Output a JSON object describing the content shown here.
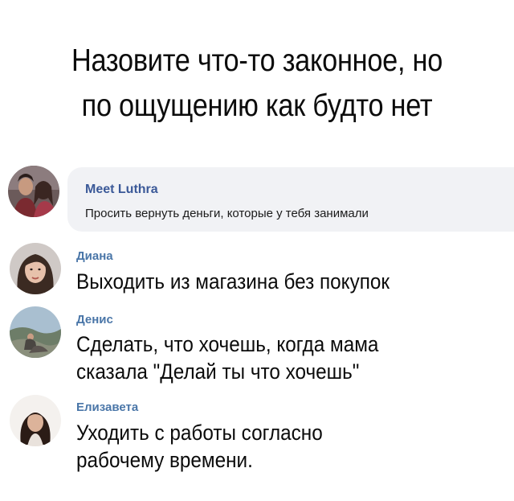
{
  "title": {
    "line1": "Назовите что-то законное, но",
    "line2": "по ощущению как будто нет"
  },
  "featured_comment": {
    "author": "Meet Luthra",
    "text": "Просить вернуть деньги, которые у тебя занимали"
  },
  "comments": [
    {
      "author": "Диана",
      "lines": [
        "Выходить из магазина без покупок"
      ]
    },
    {
      "author": "Денис",
      "lines": [
        "Сделать, что хочешь, когда мама",
        "сказала \"Делай ты что хочешь\""
      ]
    },
    {
      "author": "Елизавета",
      "lines": [
        "Уходить с работы согласно",
        "рабочему времени."
      ]
    }
  ]
}
